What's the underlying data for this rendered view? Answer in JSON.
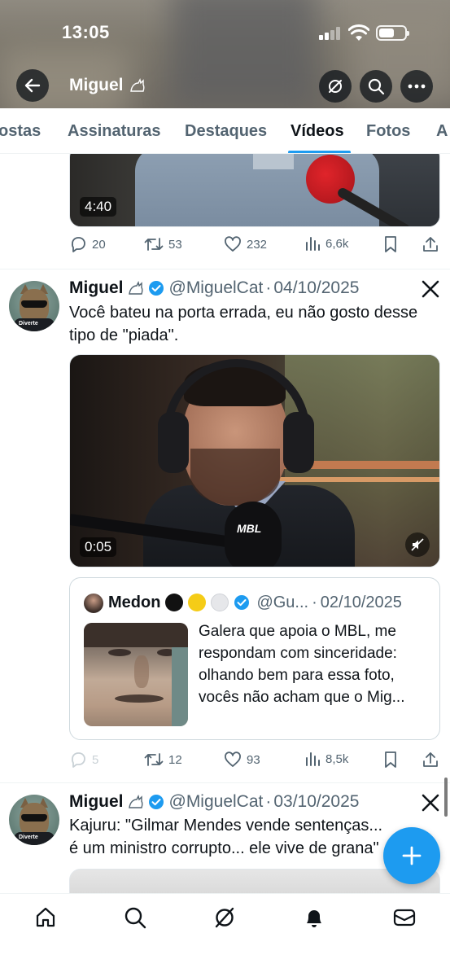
{
  "status_bar": {
    "time": "13:05"
  },
  "profile_header": {
    "name": "Miguel"
  },
  "tabs": [
    {
      "label": "ostas",
      "active": false
    },
    {
      "label": "Assinaturas",
      "active": false
    },
    {
      "label": "Destaques",
      "active": false
    },
    {
      "label": "Vídeos",
      "active": true
    },
    {
      "label": "Fotos",
      "active": false
    },
    {
      "label": "A",
      "active": false
    }
  ],
  "tweets": [
    {
      "video_duration": "4:40",
      "replies": "20",
      "reposts": "53",
      "likes": "232",
      "views": "6,6k"
    },
    {
      "name": "Miguel",
      "handle": "@MiguelCat",
      "date": "04/10/2025",
      "text": "Você bateu na porta errada, eu não gosto desse tipo de \"piada\".",
      "video_duration": "0:05",
      "video_mic_label": "MBL",
      "quote": {
        "name": "Medon",
        "handle": "@Gu...",
        "date": "02/10/2025",
        "text": "Galera que apoia o MBL, me respondam com sinceridade: olhando bem para essa foto, vocês não acham que o Mig..."
      },
      "replies": "5",
      "reposts": "12",
      "likes": "93",
      "views": "8,5k"
    },
    {
      "name": "Miguel",
      "handle": "@MiguelCat",
      "date": "03/10/2025",
      "text": "Kajuru: \"Gilmar Mendes vende sentenças... é um ministro corrupto... ele vive de grana\""
    }
  ],
  "avatar_shirt_text": "Diverte",
  "colors": {
    "accent": "#1d9bf0",
    "text_secondary": "#536471",
    "divider": "#eff3f4"
  }
}
